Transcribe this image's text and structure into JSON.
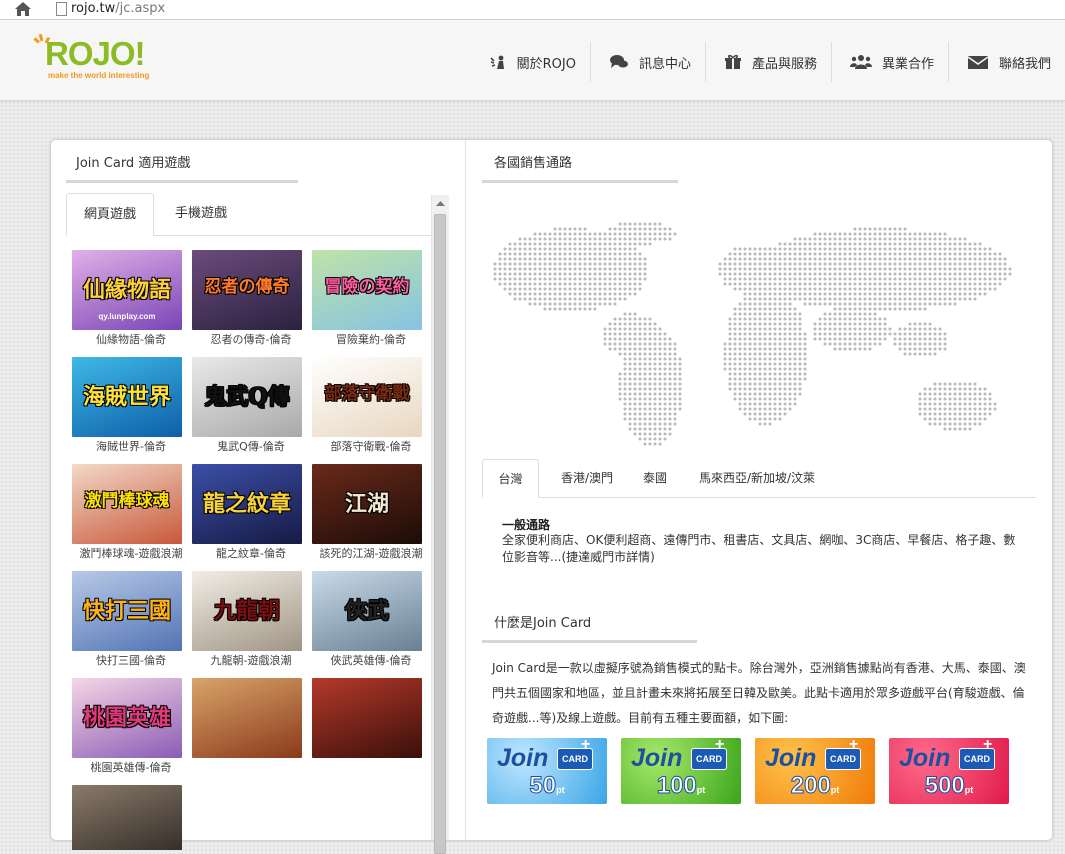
{
  "browser": {
    "url_host": "rojo.tw",
    "url_path": "/jc.aspx"
  },
  "logo": {
    "text": "ROJO!",
    "tagline": "make the world interesting"
  },
  "nav": [
    {
      "label": "關於ROJO",
      "icon": "person-wave-icon"
    },
    {
      "label": "訊息中心",
      "icon": "chat-bubbles-icon"
    },
    {
      "label": "產品與服務",
      "icon": "gift-icon"
    },
    {
      "label": "異業合作",
      "icon": "users-icon"
    },
    {
      "label": "聯絡我們",
      "icon": "envelope-icon"
    }
  ],
  "left": {
    "title": "Join Card 適用遊戲",
    "tabs": [
      "網頁遊戲",
      "手機遊戲"
    ],
    "games": [
      {
        "name": "仙緣物語-倫奇",
        "art": "仙緣物語",
        "sub": "qy.lunplay.com",
        "c1": "#e2b0e8",
        "c2": "#7a45b5",
        "tc": "#ffd23a"
      },
      {
        "name": "忍者の傳奇-倫奇",
        "art": "忍者の傳奇",
        "sub": "",
        "c1": "#6b4b7a",
        "c2": "#2a2240",
        "tc": "#ff7a2a"
      },
      {
        "name": "冒險棄約-倫奇",
        "art": "冒險の契約",
        "sub": "",
        "c1": "#bfe3a7",
        "c2": "#86c3e3",
        "tc": "#ff5fa2"
      },
      {
        "name": "海賊世界-倫奇",
        "art": "海賊世界",
        "sub": "",
        "c1": "#3fb9e6",
        "c2": "#0d5fa8",
        "tc": "#ffe23a"
      },
      {
        "name": "鬼武Q傳-倫奇",
        "art": "鬼武Q傳",
        "sub": "",
        "c1": "#e9e9e9",
        "c2": "#a9a9a9",
        "tc": "#111111"
      },
      {
        "name": "部落守衛戰-倫奇",
        "art": "部落守衛戰",
        "sub": "",
        "c1": "#ffffff",
        "c2": "#e8d7c0",
        "tc": "#7a2a10"
      },
      {
        "name": "激鬥棒球魂-遊戲浪潮",
        "art": "激鬥棒球魂",
        "sub": "",
        "c1": "#f3d9c8",
        "c2": "#c8583a",
        "tc": "#ffe000"
      },
      {
        "name": "龍之紋章-倫奇",
        "art": "龍之紋章",
        "sub": "",
        "c1": "#3c4fa8",
        "c2": "#161a44",
        "tc": "#f7d23a"
      },
      {
        "name": "該死的江湖-遊戲浪潮",
        "art": "江湖",
        "sub": "",
        "c1": "#6a2a1a",
        "c2": "#1c0c08",
        "tc": "#f2e6d2"
      },
      {
        "name": "快打三國-倫奇",
        "art": "快打三國",
        "sub": "",
        "c1": "#b8c9e6",
        "c2": "#5274b5",
        "tc": "#ffb21a"
      },
      {
        "name": "九龍朝-遊戲浪潮",
        "art": "九龍朝",
        "sub": "",
        "c1": "#f2ede4",
        "c2": "#a09486",
        "tc": "#7a0f0f"
      },
      {
        "name": "俠武英雄傳-倫奇",
        "art": "俠武",
        "sub": "",
        "c1": "#c7dbe9",
        "c2": "#6a7f93",
        "tc": "#222222"
      },
      {
        "name": "桃園英雄傳-倫奇",
        "art": "桃園英雄",
        "sub": "",
        "c1": "#f6d6e6",
        "c2": "#8a5cb5",
        "tc": "#e03a7a"
      },
      {
        "name": "",
        "art": "",
        "sub": "",
        "c1": "#d9a46a",
        "c2": "#8a3a1a",
        "tc": "#ffffff"
      },
      {
        "name": "",
        "art": "",
        "sub": "",
        "c1": "#b53a2a",
        "c2": "#3a0f0a",
        "tc": "#ffffff"
      },
      {
        "name": "",
        "art": "",
        "sub": "",
        "c1": "#8a7a6a",
        "c2": "#2a2420",
        "tc": "#ffffff"
      }
    ]
  },
  "right": {
    "title": "各國銷售通路",
    "tabs": [
      "台灣",
      "香港/澳門",
      "泰國",
      "馬來西亞/新加坡/汶萊"
    ],
    "channel_head": "一般通路",
    "channel_text": "全家便利商店、OK便利超商、遠傳門市、租書店、文具店、網咖、3C商店、早餐店、格子趣、數位影音等...(捷達威門市詳情)",
    "about_title": "什麼是Join Card",
    "about_text": "Join Card是一款以虛擬序號為銷售模式的點卡。除台灣外，亞洲銷售據點尚有香港、大馬、泰國、澳門共五個國家和地區，並且計畫未來將拓展至日韓及歐美。此點卡適用於眾多遊戲平台(育駿遊戲、倫奇遊戲...等)及線上遊戲。目前有五種主要面額，如下圖:",
    "cards": [
      {
        "join": "Join",
        "card": "CARD",
        "value": "50",
        "unit": "pt",
        "c1": "#bfe6ff",
        "c2": "#3aa5e6",
        "vc": "#ffffff"
      },
      {
        "join": "Join",
        "card": "CARD",
        "value": "100",
        "unit": "pt",
        "c1": "#a6e86a",
        "c2": "#3aa51a",
        "vc": "#ffffff"
      },
      {
        "join": "Join",
        "card": "CARD",
        "value": "200",
        "unit": "pt",
        "c1": "#ffc24a",
        "c2": "#f07a0a",
        "vc": "#ffffff"
      },
      {
        "join": "Join",
        "card": "CARD",
        "value": "500",
        "unit": "pt",
        "c1": "#ff6a8a",
        "c2": "#e01a4a",
        "vc": "#ffffff"
      }
    ]
  }
}
